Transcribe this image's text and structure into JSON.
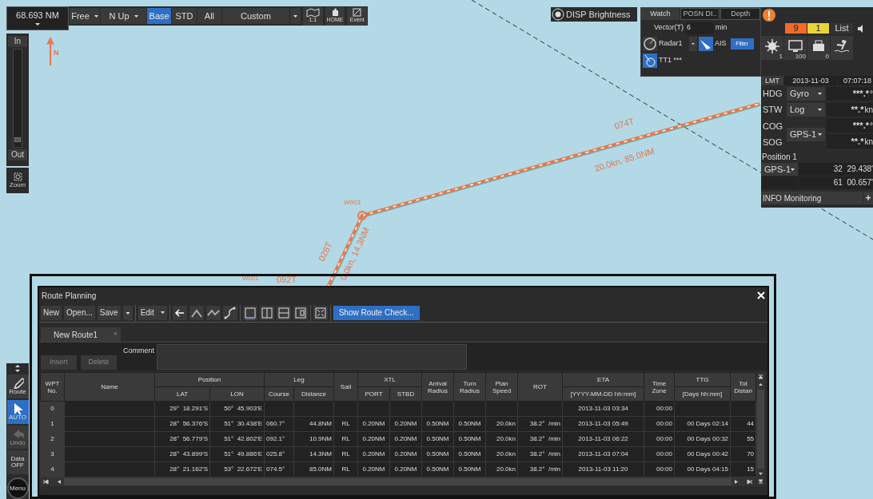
{
  "top_toolbar": {
    "range": "68.693 NM",
    "mode": "Free",
    "orientation": "N Up",
    "display_modes": [
      {
        "label": "Base",
        "selected": true
      },
      {
        "label": "STD",
        "selected": false
      },
      {
        "label": "All",
        "selected": false
      }
    ],
    "custom": "Custom",
    "tools": [
      {
        "kind": "scale",
        "label": "1:1"
      },
      {
        "kind": "home",
        "label": "HOME"
      },
      {
        "kind": "event",
        "label": "Event"
      }
    ]
  },
  "north_arrow": {
    "label": "N"
  },
  "chart_labels": [
    {
      "kind": "course",
      "text": "074T"
    },
    {
      "kind": "leg",
      "text": "20.0kn, 85.0NM"
    },
    {
      "kind": "waypoint",
      "text": "W003"
    },
    {
      "kind": "course2",
      "text": "028T"
    },
    {
      "kind": "leg2",
      "text": "0.0kn, 14.3NM"
    },
    {
      "kind": "waypoint2",
      "text": "W001"
    },
    {
      "kind": "course3",
      "text": "092T"
    }
  ],
  "disp_brightness": "DISP Brightness",
  "watch_panel": {
    "tabs": [
      {
        "label": "Watch",
        "selected": true
      },
      {
        "label": "POSN DI..",
        "selected": false
      },
      {
        "label": "Depth",
        "selected": false
      }
    ],
    "vector_label": "Vector(T)",
    "vector_value": "6",
    "vector_unit": "min",
    "radar": "Radar1",
    "ais": "AIS",
    "filter": "Filter",
    "target": "TT1 ***"
  },
  "alert_panel": {
    "counts": [
      {
        "value": "9",
        "color": "#f26a2c"
      },
      {
        "value": "1",
        "color": "#e8d43a"
      }
    ],
    "list": "List",
    "sensors": [
      {
        "kind": "sun",
        "count": "1"
      },
      {
        "kind": "monitor",
        "count": "100"
      },
      {
        "kind": "device",
        "count": "0"
      },
      {
        "kind": "person"
      }
    ]
  },
  "nav_panel": {
    "time_ref": "LMT",
    "date": "2013-11-03",
    "time": "07:07:18",
    "rows": [
      {
        "label": "HDG",
        "source": "Gyro",
        "value": "***.*",
        "unit": "°"
      },
      {
        "label": "STW",
        "source": "Log",
        "value": "**.*",
        "unit": "kn"
      }
    ],
    "cog_label": "COG",
    "sog_label": "SOG",
    "cog_sog_source": "GPS-1",
    "cog_value": "***.*",
    "cog_unit": "°",
    "sog_value": "**.*",
    "sog_unit": "kn",
    "position_label": "Position 1",
    "position_source": "GPS-1",
    "lat": "32  29.438'",
    "lon": "61  00.657'",
    "info": "INFO Monitoring",
    "info_add": "+"
  },
  "zoom_panel": {
    "in": "In",
    "out": "Out",
    "zoom": "Zoom",
    "level": 0.05
  },
  "side_tools": [
    {
      "label": "Route",
      "kind": "pencil",
      "selected": false,
      "disabled": false
    },
    {
      "label": "AUTO",
      "kind": "cursor",
      "selected": true,
      "disabled": false
    },
    {
      "label": "Undo",
      "kind": "undo",
      "selected": false,
      "disabled": true
    },
    {
      "label": "Data OFF",
      "kind": "text",
      "selected": false,
      "disabled": false
    },
    {
      "label": "Menu",
      "kind": "menu",
      "selected": false,
      "disabled": false
    }
  ],
  "route_planning": {
    "title": "Route Planning",
    "toolbar": [
      "New",
      "Open...",
      "Save"
    ],
    "edit": "Edit",
    "show_route_check": "Show Route Check...",
    "tab": "New Route1",
    "tab_close": "×",
    "insert": "Insert",
    "delete": "Delete",
    "insert_disabled": true,
    "comment_label": "Comment",
    "table": {
      "groups": [
        {
          "label": "WPT No."
        },
        {
          "label": "Name"
        },
        {
          "label": "Position",
          "subs": [
            "LAT",
            "LON"
          ]
        },
        {
          "label": "Leg",
          "subs": [
            "Course",
            "Distance"
          ]
        },
        {
          "label": "Sail"
        },
        {
          "label": "XTL",
          "subs": [
            "PORT",
            "STBD"
          ]
        },
        {
          "label": "Arrival Radius"
        },
        {
          "label": "Turn Radius"
        },
        {
          "label": "Plan Speed"
        },
        {
          "label": "ROT"
        },
        {
          "label": "ETA",
          "subs": [
            "[YYYY-MM-DD hh:mm]"
          ]
        },
        {
          "label": "Time Zone"
        },
        {
          "label": "TTG",
          "subs": [
            "[Days hh:mm]"
          ]
        },
        {
          "label": "Tot Distan"
        }
      ],
      "rows": [
        {
          "wpt": "0",
          "lat": "29°  18.291'S",
          "lon": "50°  45.903'E",
          "eta": "2013-11-03 03:34",
          "tz": "00:00"
        },
        {
          "wpt": "1",
          "lat": "28°  56.376'S",
          "lon": "51°  30.438'E",
          "course": "060.7°",
          "dist": "44.8NM",
          "sail": "RL",
          "port": "0.20NM",
          "stbd": "0.20NM",
          "arr": "0.50NM",
          "turn": "0.50NM",
          "speed": "20.0kn",
          "rot": "38.2°  /min",
          "eta": "2013-11-03 05:49",
          "tz": "00:00",
          "ttg": "00 Days 02:14",
          "tot": "44"
        },
        {
          "wpt": "2",
          "lat": "28°  56.779'S",
          "lon": "51°  42.802'E",
          "course": "092.1°",
          "dist": "10.9NM",
          "sail": "RL",
          "port": "0.20NM",
          "stbd": "0.20NM",
          "arr": "0.50NM",
          "turn": "0.50NM",
          "speed": "20.0kn",
          "rot": "38.2°  /min",
          "eta": "2013-11-03 06:22",
          "tz": "00:00",
          "ttg": "00 Days 00:32",
          "tot": "55"
        },
        {
          "wpt": "3",
          "lat": "28°  43.899'S",
          "lon": "51°  49.886'E",
          "course": "025.8°",
          "dist": "14.3NM",
          "sail": "RL",
          "port": "0.20NM",
          "stbd": "0.20NM",
          "arr": "0.50NM",
          "turn": "0.50NM",
          "speed": "20.0kn",
          "rot": "38.2°  /min",
          "eta": "2013-11-03 07:04",
          "tz": "00:00",
          "ttg": "00 Days 00:42",
          "tot": "70"
        },
        {
          "wpt": "4",
          "lat": "28°  21.162'S",
          "lon": "53°  22.672'E",
          "course": "074.5°",
          "dist": "85.0NM",
          "sail": "RL",
          "port": "0.20NM",
          "stbd": "0.20NM",
          "arr": "0.50NM",
          "turn": "0.50NM",
          "speed": "20.0kn",
          "rot": "38.2°  /min",
          "eta": "2013-11-03 11:20",
          "tz": "00:00",
          "ttg": "00 Days 04:15",
          "tot": "15"
        }
      ]
    }
  }
}
